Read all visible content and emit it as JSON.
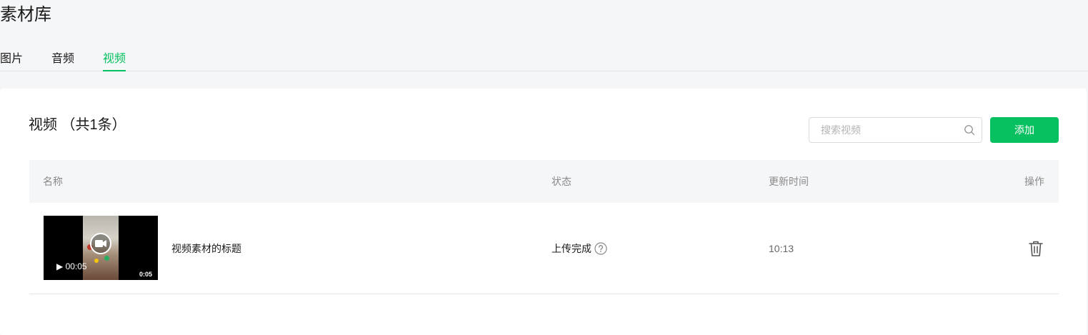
{
  "page": {
    "title": "素材库"
  },
  "tabs": [
    {
      "label": "图片",
      "active": false
    },
    {
      "label": "音频",
      "active": false
    },
    {
      "label": "视频",
      "active": true
    }
  ],
  "panel": {
    "title": "视频 （共1条）",
    "search": {
      "placeholder": "搜索视频",
      "value": ""
    },
    "add_label": "添加"
  },
  "table": {
    "columns": [
      "名称",
      "状态",
      "更新时间",
      "操作"
    ],
    "rows": [
      {
        "name": "视频素材的标题",
        "status": "上传完成",
        "updated": "10:13",
        "player_time": "▶ 00:05",
        "duration": "0:05"
      }
    ]
  },
  "colors": {
    "accent": "#07c160",
    "background": "#f5f6f8",
    "muted": "#8a8a8a"
  },
  "icons": {
    "search": "search-icon",
    "help": "help-icon",
    "delete": "trash-icon",
    "camera": "video-camera-icon"
  }
}
